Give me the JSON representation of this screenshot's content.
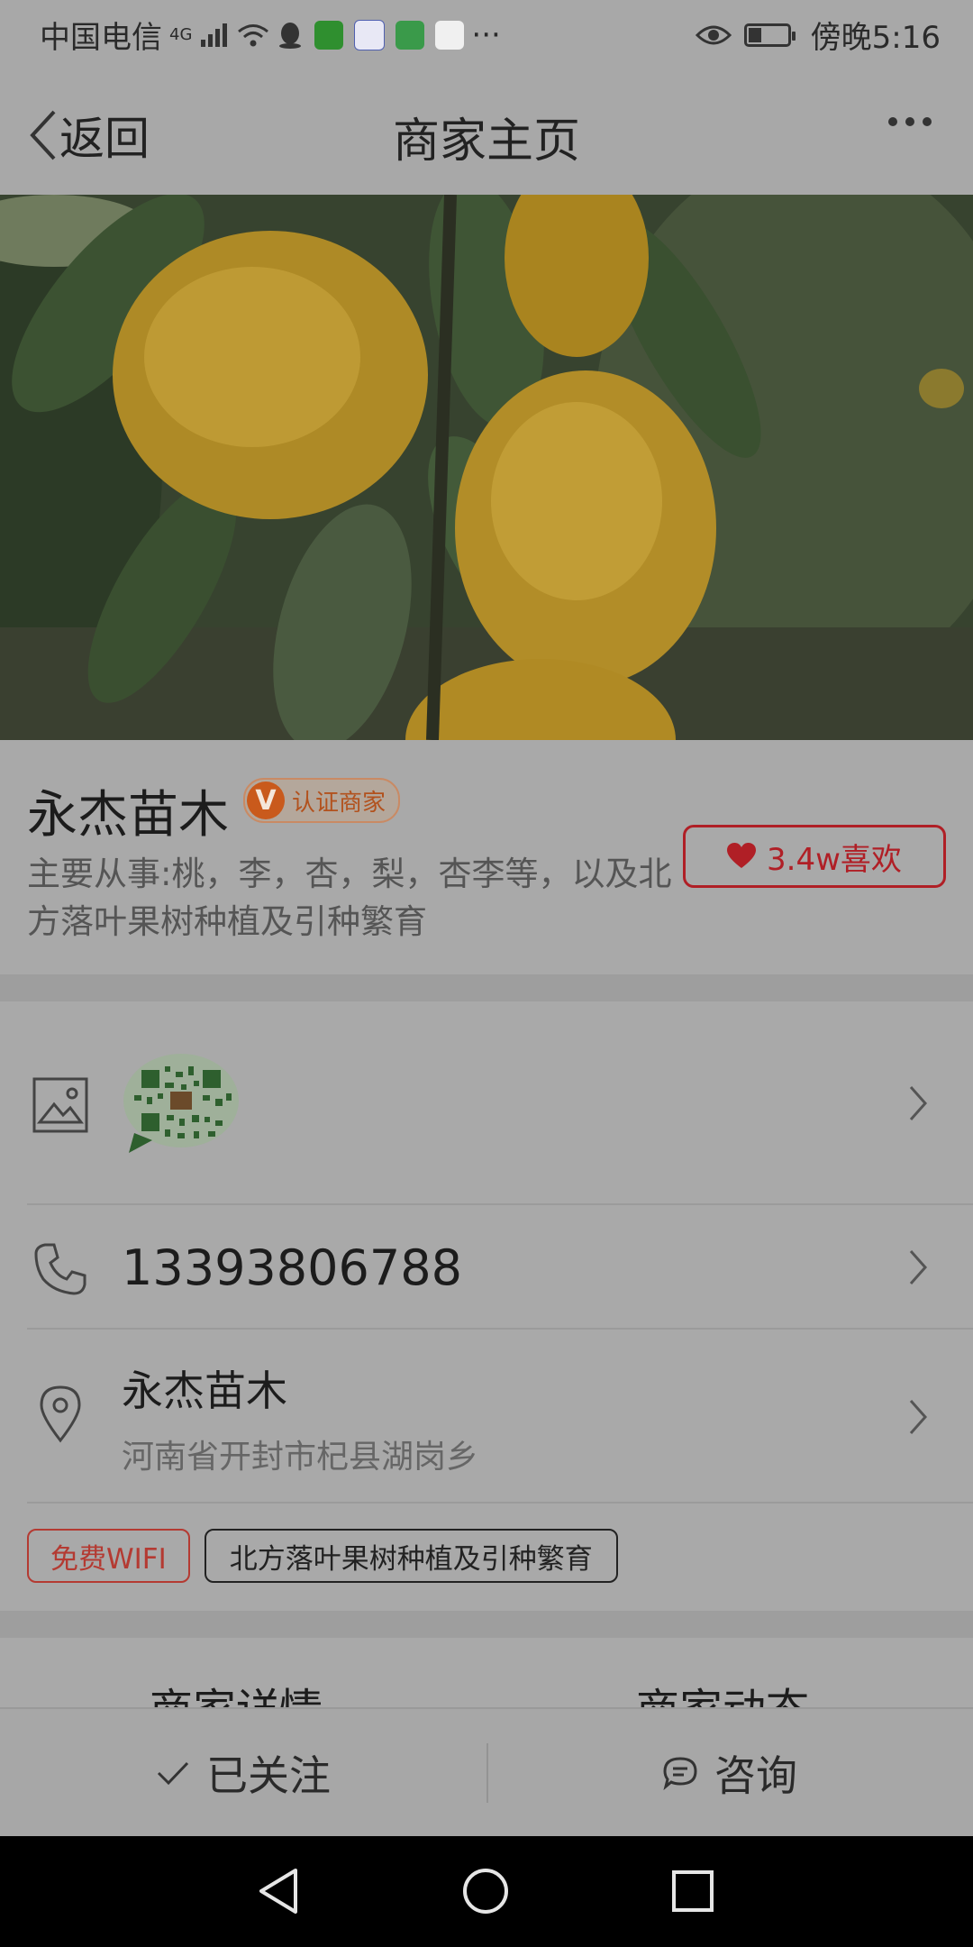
{
  "status_bar": {
    "carrier": "中国电信",
    "network": "4G",
    "time": "傍晚5:16",
    "more": "···",
    "battery_level": 0.36
  },
  "nav": {
    "back_label": "返回",
    "title": "商家主页"
  },
  "merchant": {
    "name": "永杰苗木",
    "verified_mark": "V",
    "verified_label": "认证商家",
    "description": "主要从事:桃，李，杏，梨，杏李等，以及北方落叶果树种植及引种繁育",
    "likes_label": "3.4w喜欢"
  },
  "contact": {
    "phone": "13393806788",
    "location_name": "永杰苗木",
    "address": "河南省开封市杞县湖岗乡"
  },
  "tags": [
    "免费WIFI",
    "北方落叶果树种植及引种繁育"
  ],
  "tabs": [
    "商家详情",
    "商家动态"
  ],
  "actions": {
    "follow_label": "已关注",
    "consult_label": "咨询"
  },
  "icons": {
    "back": "chevron-left-icon",
    "more": "more-dots-icon",
    "image": "image-icon",
    "phone": "phone-icon",
    "location": "location-pin-icon",
    "chevron": "chevron-right-icon",
    "heart": "heart-icon",
    "check": "check-icon",
    "chat": "chat-bubble-icon"
  },
  "colors": {
    "accent_red": "#b01f26",
    "verified_orange": "#c95a1c",
    "overlay_gray": "#a9a9a9"
  }
}
